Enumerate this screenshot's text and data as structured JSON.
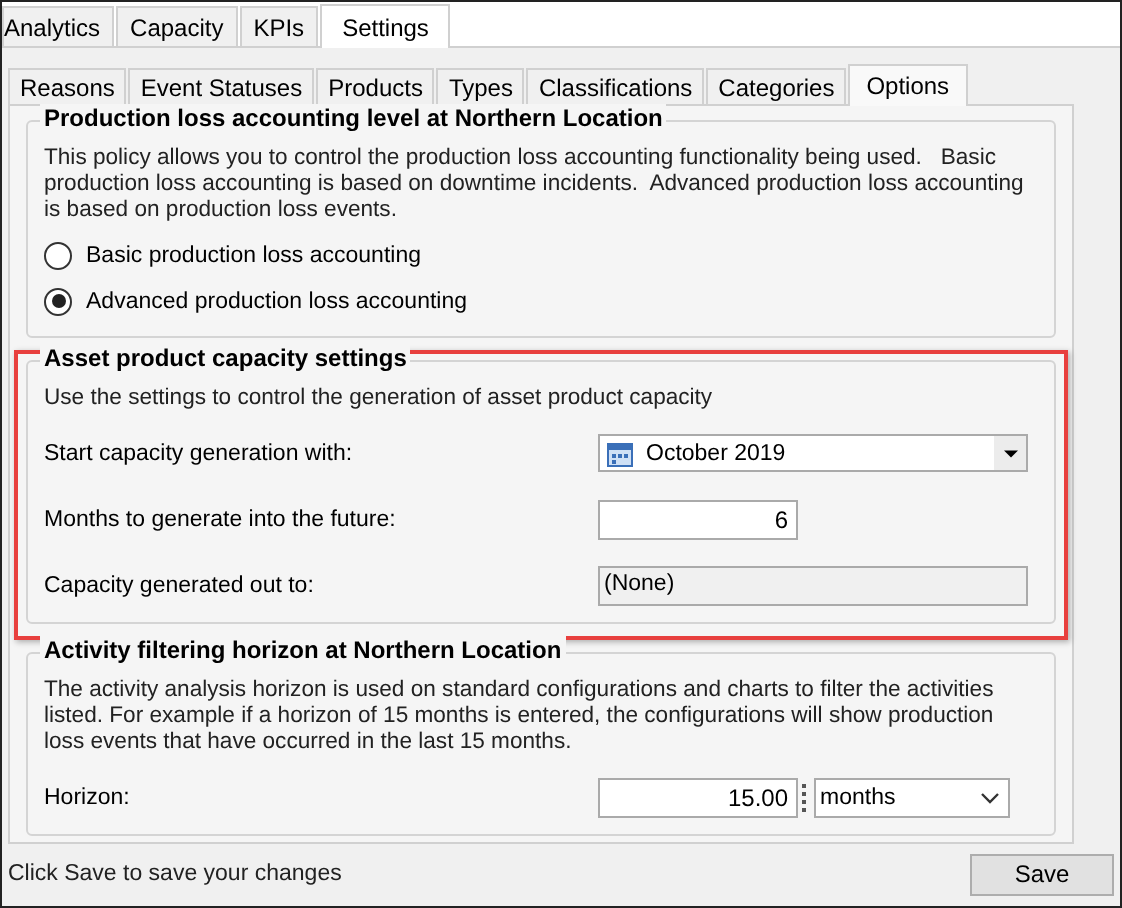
{
  "top_tabs": [
    {
      "label": "Analytics",
      "selected": false
    },
    {
      "label": "Capacity",
      "selected": false
    },
    {
      "label": "KPIs",
      "selected": false
    },
    {
      "label": "Settings",
      "selected": true
    }
  ],
  "sub_tabs": [
    {
      "label": "Reasons",
      "selected": false
    },
    {
      "label": "Event Statuses",
      "selected": false
    },
    {
      "label": "Products",
      "selected": false
    },
    {
      "label": "Types",
      "selected": false
    },
    {
      "label": "Classifications",
      "selected": false
    },
    {
      "label": "Categories",
      "selected": false
    },
    {
      "label": "Options",
      "selected": true
    }
  ],
  "groups": [
    {
      "kind": "radio",
      "highlighted": false,
      "title": "Production loss accounting level at Northern Location",
      "description": "This policy allows you to control the production loss accounting functionality being used.   Basic production loss accounting is based on downtime incidents.  Advanced production loss accounting is based on production loss events.",
      "options": [
        {
          "label": "Basic production loss accounting",
          "selected": false
        },
        {
          "label": "Advanced production loss accounting",
          "selected": true
        }
      ]
    },
    {
      "kind": "form",
      "highlighted": true,
      "title": "Asset product capacity settings",
      "description": "Use the settings to control the generation of asset product capacity",
      "fields": [
        {
          "kind": "date",
          "label": "Start capacity generation with:",
          "value": "October 2019"
        },
        {
          "kind": "number",
          "label": "Months to generate into the future:",
          "value": "6"
        },
        {
          "kind": "readonly",
          "label": "Capacity generated out to:",
          "value": "(None)"
        }
      ]
    },
    {
      "kind": "form",
      "highlighted": false,
      "title": "Activity filtering horizon at Northern Location",
      "description": "The activity analysis horizon is used on standard configurations and charts to filter the activities listed. For example if a horizon of 15 months is entered, the configurations will show production loss events that have occurred in the last 15 months.",
      "fields": [
        {
          "kind": "unit",
          "label": "Horizon:",
          "value": "15.00",
          "unit": "months"
        }
      ]
    }
  ],
  "status_text": "Click Save to save your changes",
  "save_button": "Save"
}
